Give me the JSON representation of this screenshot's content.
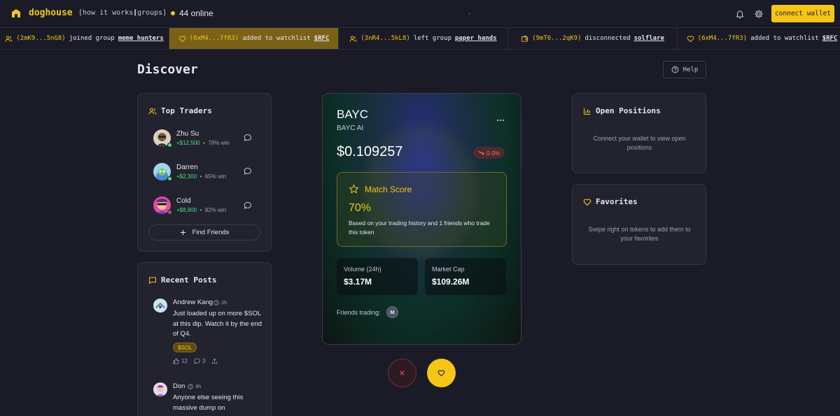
{
  "header": {
    "brand": "doghouse",
    "nav": [
      "[how it works]",
      "[groups]"
    ],
    "online": "44 online",
    "connect_label": "connect wallet"
  },
  "ticker": [
    {
      "icon": "users-icon",
      "addr": "(2mK9...5nG8)",
      "action": "joined group",
      "target": "meme_hunters",
      "active": false
    },
    {
      "icon": "heart-icon",
      "addr": "(6xM4...7fR3)",
      "action": "added to watchlist",
      "target": "$RFC",
      "active": true
    },
    {
      "icon": "users-icon",
      "addr": "(3nR4...5kL8)",
      "action": "left group",
      "target": "paper_hands",
      "active": false
    },
    {
      "icon": "wallet-icon",
      "addr": "(9mT6...2qK9)",
      "action": "disconnected",
      "target": "solflare",
      "active": false
    },
    {
      "icon": "heart-icon",
      "addr": "(6xM4...7fR3)",
      "action": "added to watchlist",
      "target": "$RFC",
      "active": false
    }
  ],
  "page": {
    "title": "Discover",
    "help_label": "Help"
  },
  "top_traders": {
    "title": "Top Traders",
    "traders": [
      {
        "name": "Zhu Su",
        "pnl": "+$12,500",
        "sep": "•",
        "win": "78% win",
        "status": "online"
      },
      {
        "name": "Darren",
        "pnl": "+$2,300",
        "sep": "•",
        "win": "65% win",
        "status": "online"
      },
      {
        "name": "Cold",
        "pnl": "+$8,900",
        "sep": "•",
        "win": "82% win",
        "status": "offline"
      }
    ],
    "find_label": "Find Friends"
  },
  "recent_posts": {
    "title": "Recent Posts",
    "posts": [
      {
        "name": "Andrew Kang",
        "time": "2h",
        "body": "Just loaded up on more $SOL at this dip. Watch it by the end of Q4.",
        "tag": "$SOL",
        "likes": "12",
        "comments": "3"
      },
      {
        "name": "Don",
        "time": "4h",
        "body": "Anyone else seeing this massive dump on"
      }
    ]
  },
  "token": {
    "symbol": "BAYC",
    "name": "BAYC AI",
    "price": "$0.109257",
    "change": "0.0%",
    "match_title": "Match Score",
    "match_pct": "70%",
    "match_desc": "Based on your trading history and 1 friends who trade this token",
    "volume_label": "Volume (24h)",
    "volume": "$3.17M",
    "mcap_label": "Market Cap",
    "mcap": "$109.26M",
    "friends_label": "Friends trading:",
    "friend_initial": "M"
  },
  "open_positions": {
    "title": "Open Positions",
    "empty": "Connect your wallet to view open positions"
  },
  "favorites": {
    "title": "Favorites",
    "empty": "Swipe right on tokens to add them to your favorites"
  },
  "colors": {
    "accent": "#f5c518",
    "background": "#1a1b26",
    "panel": "#22232f",
    "positive": "#4ade80",
    "negative": "#f87171"
  }
}
